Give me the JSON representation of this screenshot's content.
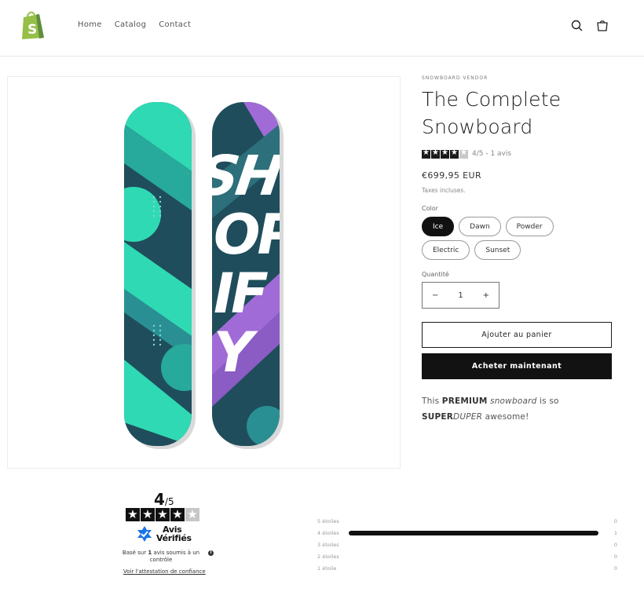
{
  "header": {
    "nav": [
      "Home",
      "Catalog",
      "Contact"
    ],
    "icons": [
      "shopify-bag-logo",
      "search-icon",
      "cart-icon"
    ]
  },
  "product": {
    "vendor": "SNOWBOARD VENDOR",
    "title": "The Complete Snowboard",
    "rating_text": "4/5 - 1 avis",
    "rating_value": 4,
    "rating_max": 5,
    "price": "€699,95 EUR",
    "tax_note": "Taxes incluses.",
    "option_label": "Color",
    "colors": [
      "Ice",
      "Dawn",
      "Powder",
      "Electric",
      "Sunset"
    ],
    "selected_color": "Ice",
    "quantity_label": "Quantité",
    "quantity": "1",
    "qty_minus": "−",
    "qty_plus": "+",
    "add_to_cart": "Ajouter au panier",
    "buy_now": "Acheter maintenant",
    "description": {
      "p1": "This ",
      "bold1": "PREMIUM",
      "p2": " ",
      "italic1": "snowboard",
      "p3": " is so ",
      "bold2": "SUPER",
      "italic2": "DUPER",
      "p4": " awesome!"
    },
    "image_text": "SHOPIFY"
  },
  "reviews": {
    "score": "4",
    "score_max": "/5",
    "stars": 4,
    "brand_line1": "Avis",
    "brand_line2": "Vérifiés",
    "based_pre": "Basé sur ",
    "based_count": "1",
    "based_post": " avis soumis à un contrôle",
    "info_icon": "i",
    "attestation_link": "Voir l'attestation de confiance",
    "distribution": [
      {
        "label": "5 étoiles",
        "count": "0",
        "fraction": 0
      },
      {
        "label": "4 étoiles",
        "count": "1",
        "fraction": 1
      },
      {
        "label": "3 étoiles",
        "count": "0",
        "fraction": 0
      },
      {
        "label": "2 étoiles",
        "count": "0",
        "fraction": 0
      },
      {
        "label": "1 étoile",
        "count": "0",
        "fraction": 0
      }
    ]
  },
  "colors": {
    "accent": "#111111",
    "logo_green": "#95bf47",
    "board_teal": "#2fd9b3",
    "board_dark": "#1f4d5c",
    "board_purple": "#a06bd6"
  }
}
